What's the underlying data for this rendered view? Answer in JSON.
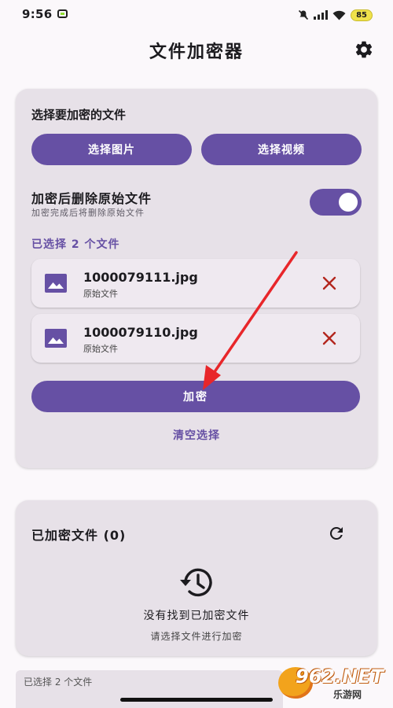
{
  "status_bar": {
    "time": "9:56",
    "battery": "85"
  },
  "header": {
    "title": "文件加密器"
  },
  "select_card": {
    "title": "选择要加密的文件",
    "select_images_label": "选择图片",
    "select_videos_label": "选择视频",
    "delete_toggle_label": "加密后删除原始文件",
    "delete_toggle_sub": "加密完成后将删除原始文件",
    "delete_toggle_on": true,
    "selected_count": "已选择 2 个文件",
    "files": [
      {
        "name": "1000079111.jpg",
        "sub": "原始文件"
      },
      {
        "name": "1000079110.jpg",
        "sub": "原始文件"
      }
    ],
    "encrypt_label": "加密",
    "clear_label": "清空选择"
  },
  "encrypted_card": {
    "title": "已加密文件 (0)",
    "empty_text": "没有找到已加密文件",
    "empty_sub": "请选择文件进行加密"
  },
  "next_card_peek": "已选择 2 个文件",
  "watermark": {
    "main": "962.NET",
    "sub": "乐游网"
  },
  "colors": {
    "accent": "#6650a4",
    "card": "#e7e1e8",
    "remove": "#b3261e",
    "annotation_arrow": "#e8262a"
  }
}
